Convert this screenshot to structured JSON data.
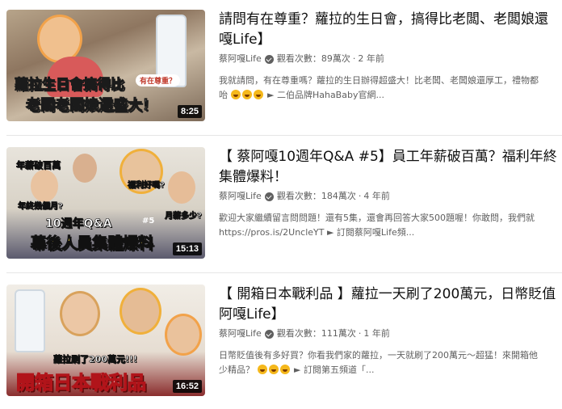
{
  "colors": {
    "title": "#0f0f0f",
    "meta": "#606060",
    "duration_bg": "#000000"
  },
  "videos": [
    {
      "title_line1": "請問有在尊重？蘿拉的生日會，搞得比老闆、老闆娘還",
      "title_line2": "嘎Life】",
      "channel": "蔡阿嘎Life",
      "views": "觀看次數：89萬次",
      "age": "2 年前",
      "desc_line1": "我就請問，有在尊重嗎？蘿拉的生日辦得超盛大！比老闆、老闆娘還厚工，禮物都",
      "desc_line2_prefix": "咍",
      "desc_line2_suffix": "► 二伯品牌HahaBaby官網...",
      "duration": "8:25",
      "thumb_text_1": "蘿拉生日會搞得比",
      "thumb_text_2": "老闆老闆娘還盛大！",
      "thumb_bubble": "有在尊重？"
    },
    {
      "title_line1": "【 蔡阿嘎10週年Q&A #5】員工年薪破百萬？福利年終",
      "title_line2": "集體爆料！",
      "channel": "蔡阿嘎Life",
      "views": "觀看次數：184萬次",
      "age": "4 年前",
      "desc_line1": "歡迎大家繼續留言問問題！還有5集，還會再回答大家500題喔！你敢問，我們就",
      "desc_line2_prefix": "https://pros.is/2UncleYT ► 訂閱蔡阿嘎Life頻...",
      "desc_line2_suffix": "",
      "duration": "15:13",
      "thumb_text_1": "年薪破百萬",
      "thumb_text_2": "幕後人員集體爆料",
      "thumb_text_3": "10週年Q&A",
      "thumb_text_4": "福利好嗎?",
      "thumb_text_5": "年終幾個月?",
      "thumb_text_6": "月薪多少?",
      "thumb_tag": "#5"
    },
    {
      "title_line1": "【 開箱日本戰利品 】蘿拉一天刷了200萬元，日幣貶值",
      "title_line2": "阿嘎Life】",
      "channel": "蔡阿嘎Life",
      "views": "觀看次數：111萬次",
      "age": "1 年前",
      "desc_line1": "日幣貶值後有多好買？你看我們家的蘿拉，一天就刷了200萬元～超猛！來開箱他",
      "desc_line2_prefix": "少精品？",
      "desc_line2_suffix": "► 訂閱第五頻道「...",
      "duration": "16:52",
      "thumb_text_1": "開箱日本戰利品",
      "thumb_text_2": "蘿拉刷了200萬元!!!"
    }
  ]
}
